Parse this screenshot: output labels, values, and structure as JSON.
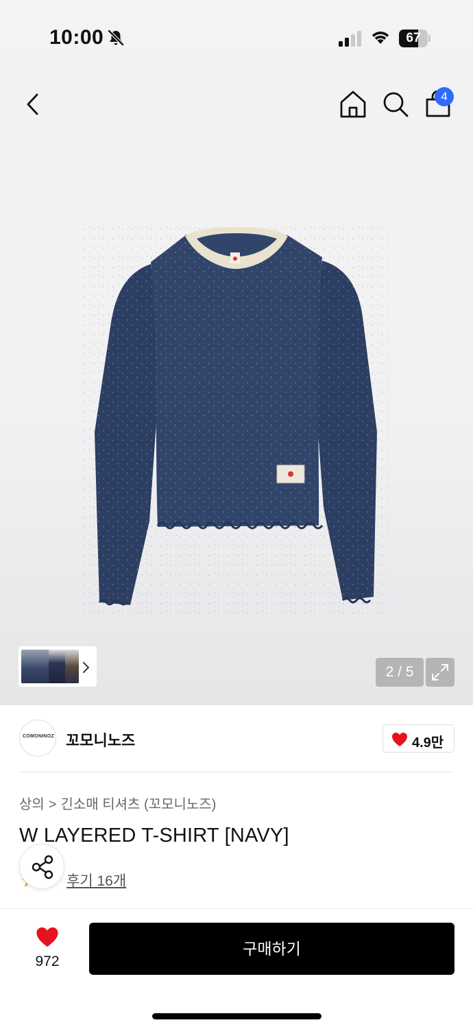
{
  "status_bar": {
    "time": "10:00",
    "battery_percent": "67",
    "battery_level": 0.67,
    "icons": [
      "bell-slash-icon",
      "cellular-signal-icon",
      "wifi-icon",
      "battery-icon"
    ]
  },
  "nav": {
    "icons": [
      "chevron-left-icon",
      "home-icon",
      "search-icon",
      "shopping-bag-icon"
    ],
    "cart_badge": "4"
  },
  "gallery": {
    "page_counter": "2 / 5",
    "icons": [
      "chevron-right-icon",
      "expand-icon"
    ]
  },
  "brand": {
    "logo_text": "COMONINOZ",
    "name": "꼬모니노즈",
    "like_count": "4.9만"
  },
  "breadcrumb": {
    "level1": "상의",
    "separator": ">",
    "level2": "긴소매 티셔츠 (꼬모니노즈)"
  },
  "product": {
    "title": "W LAYERED T-SHIRT [NAVY]",
    "review_link": "후기 16개"
  },
  "bottom_bar": {
    "like_count": "972",
    "buy_label": "구매하기"
  },
  "colors": {
    "accent_blue": "#2f6bff",
    "heart_red": "#e8121f",
    "buy_button": "#000000",
    "sweater_navy": "#2c3e61",
    "collar_cream": "#e8e2cf"
  }
}
